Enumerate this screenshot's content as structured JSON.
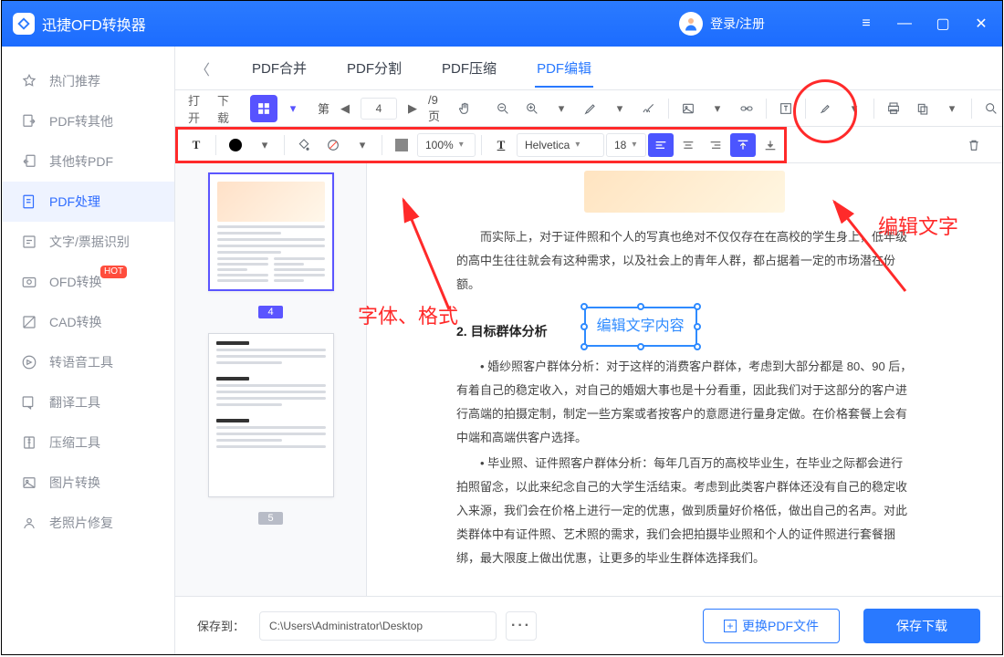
{
  "app": {
    "title": "迅捷OFD转换器",
    "login": "登录/注册"
  },
  "sidebar": {
    "items": [
      {
        "label": "热门推荐"
      },
      {
        "label": "PDF转其他"
      },
      {
        "label": "其他转PDF"
      },
      {
        "label": "PDF处理"
      },
      {
        "label": "文字/票据识别"
      },
      {
        "label": "OFD转换",
        "hot": "HOT"
      },
      {
        "label": "CAD转换"
      },
      {
        "label": "转语音工具"
      },
      {
        "label": "翻译工具"
      },
      {
        "label": "压缩工具"
      },
      {
        "label": "图片转换"
      },
      {
        "label": "老照片修复"
      }
    ]
  },
  "tabs": [
    {
      "label": "PDF合并"
    },
    {
      "label": "PDF分割"
    },
    {
      "label": "PDF压缩"
    },
    {
      "label": "PDF编辑"
    }
  ],
  "toolbar": {
    "open": "打开",
    "download": "下载",
    "page_prefix": "第",
    "page_current": "4",
    "page_total": "/9 页",
    "opacity": "100%",
    "font": "Helvetica",
    "font_size": "18"
  },
  "content": {
    "p1": "而实际上，对于证件照和个人的写真也绝对不仅仅存在在高校的学生身上，低年级的高中生往往就会有这种需求，以及社会上的青年人群，都占据着一定的市场潜在份额。",
    "h1": "2. 目标群体分析",
    "edit_text": "编辑文字内容",
    "p2": "• 婚纱照客户群体分析：对于这样的消费客户群体，考虑到大部分都是 80、90 后，有着自己的稳定收入，对自己的婚姻大事也是十分看重，因此我们对于这部分的客户进行高端的拍摄定制，制定一些方案或者按客户的意愿进行量身定做。在价格套餐上会有中端和高端供客户选择。",
    "p3": "• 毕业照、证件照客户群体分析：每年几百万的高校毕业生，在毕业之际都会进行拍照留念，以此来纪念自己的大学生活结束。考虑到此类客户群体还没有自己的稳定收入来源，我们会在价格上进行一定的优惠，做到质量好价格低，做出自己的名声。对此类群体中有证件照、艺术照的需求，我们会把拍摄毕业照和个人的证件照进行套餐捆绑，最大限度上做出优惠，让更多的毕业生群体选择我们。"
  },
  "thumbs": {
    "page4": "4",
    "page5": "5"
  },
  "footer": {
    "save_label": "保存到：",
    "path": "C:\\Users\\Administrator\\Desktop",
    "change": "更换PDF文件",
    "save": "保存下载"
  },
  "annotations": {
    "font_format": "字体、格式",
    "edit_text": "编辑文字"
  }
}
